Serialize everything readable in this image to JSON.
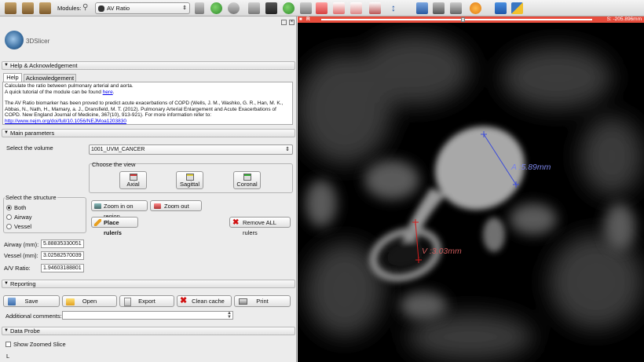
{
  "toolbar": {
    "modules_label": "Modules:",
    "module_selected": "AV Ratio"
  },
  "app": {
    "logo_text": "3DSlicer"
  },
  "help": {
    "header": "Help & Acknowledgement",
    "tabs": [
      "Help",
      "Acknowledgement"
    ],
    "line1": "Calculate the ratio between pulmonary arterial and aorta.",
    "line2_prefix": "A quick tutorial of the module can be found ",
    "line2_link": "here",
    "line2_suffix": ".",
    "para2": "The AV Ratio biomarker has been proved to predict acute exacerbations of COPD (Wells, J. M., Washko, G. R., Han, M. K., Abbas, N., Nath, H., Mamary, a. J., Dransfield, M. T. (2012). Pulmonary Arterial Enlargement and Acute Exacerbations of COPD. New England Journal of Medicine, 367(10), 913-921). For more information refer to:",
    "url": "http://www.nejm.org/doi/full/10.1056/NEJMoa1203830"
  },
  "main": {
    "header": "Main parameters",
    "volume_label": "Select the volume",
    "volume_value": "1001_UVM_CANCER",
    "view_group_title": "Choose the view",
    "views": [
      "Axial",
      "Sagittal",
      "Coronal"
    ],
    "structure_group_title": "Select the structure",
    "structures": [
      "Both",
      "Airway",
      "Vessel"
    ],
    "zoom_in": "Zoom in on region",
    "zoom_out": "Zoom out",
    "place_ruler": "Place ruler/s",
    "remove_rulers": "Remove ALL rulers",
    "airway_label": "Airway (mm):",
    "airway_value": "5.88835330051",
    "vessel_label": "Vessel (mm):",
    "vessel_value": "3.02582570039",
    "ratio_label": "A/V Ratio:",
    "ratio_value": "1.94603188801"
  },
  "reporting": {
    "header": "Reporting",
    "save": "Save",
    "open": "Open",
    "export": "Export",
    "clean_cache": "Clean cache",
    "print": "Print",
    "comments_label": "Additional comments:"
  },
  "probe": {
    "header": "Data Probe",
    "show_zoomed": "Show Zoomed Slice",
    "coord_letter": "L"
  },
  "view": {
    "slice_letter": "R",
    "slice_offset": "S: -205.896mm",
    "ruler_a": "A :5.89mm",
    "ruler_v": "V :3.03mm",
    "ruler_a_color": "#3b4bd8",
    "ruler_v_color": "#d11c1c"
  }
}
